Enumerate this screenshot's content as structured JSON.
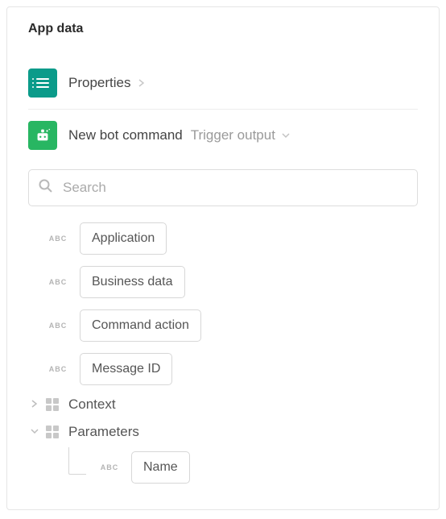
{
  "panel": {
    "title": "App data"
  },
  "sections": {
    "properties": {
      "label": "Properties"
    },
    "bot": {
      "label": "New bot command",
      "sub": "Trigger output"
    }
  },
  "search": {
    "placeholder": "Search"
  },
  "fields": {
    "type_badge": "ABC",
    "items": {
      "application": "Application",
      "business_data": "Business data",
      "command_action": "Command action",
      "message_id": "Message ID"
    }
  },
  "tree": {
    "context": "Context",
    "parameters": "Parameters",
    "name": "Name"
  }
}
